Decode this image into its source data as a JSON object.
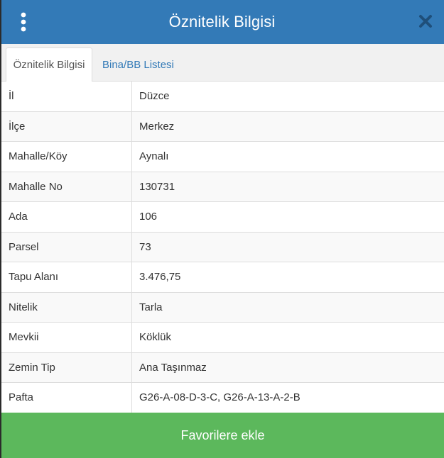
{
  "header": {
    "title": "Öznitelik Bilgisi",
    "menu_icon": "vertical-dots-icon",
    "close_icon": "close-icon",
    "bg_color": "#337ab7"
  },
  "tabs": [
    {
      "label": "Öznitelik Bilgisi",
      "active": true
    },
    {
      "label": "Bina/BB Listesi",
      "active": false
    }
  ],
  "attributes": [
    {
      "key": "İl",
      "value": "Düzce"
    },
    {
      "key": "İlçe",
      "value": "Merkez"
    },
    {
      "key": "Mahalle/Köy",
      "value": "Aynalı"
    },
    {
      "key": "Mahalle No",
      "value": "130731"
    },
    {
      "key": "Ada",
      "value": "106"
    },
    {
      "key": "Parsel",
      "value": "73"
    },
    {
      "key": "Tapu Alanı",
      "value": "3.476,75"
    },
    {
      "key": "Nitelik",
      "value": "Tarla"
    },
    {
      "key": "Mevkii",
      "value": "Köklük"
    },
    {
      "key": "Zemin Tip",
      "value": "Ana Taşınmaz"
    },
    {
      "key": "Pafta",
      "value": "G26-A-08-D-3-C, G26-A-13-A-2-B"
    }
  ],
  "footer": {
    "favorite_label": "Favorilere ekle",
    "bg_color": "#5cb85c"
  }
}
